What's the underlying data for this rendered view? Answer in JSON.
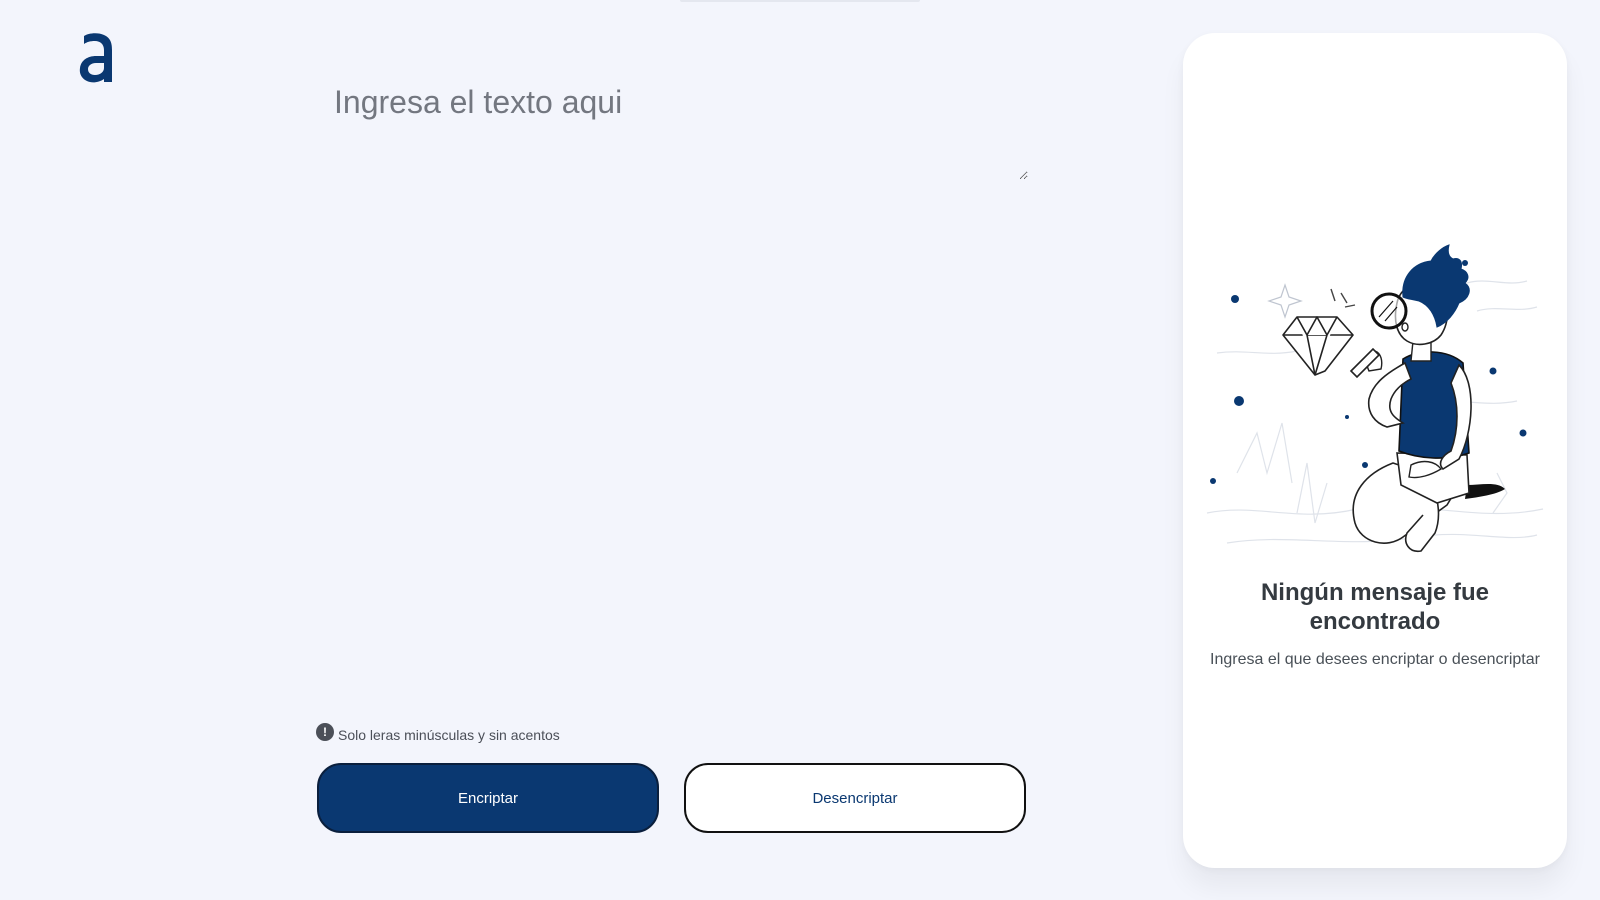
{
  "input": {
    "placeholder": "Ingresa el texto aqui",
    "value": ""
  },
  "hint": {
    "icon": "exclamation-circle-icon",
    "text": "Solo leras minúsculas y sin acentos"
  },
  "buttons": {
    "encrypt_label": "Encriptar",
    "decrypt_label": "Desencriptar"
  },
  "result_panel": {
    "title": "Ningún mensaje fue encontrado",
    "subtitle": "Ingresa el que desees encriptar o desencriptar",
    "illustration": "person-with-magnifying-glass-illustration"
  },
  "logo": {
    "icon": "alura-a-logo"
  },
  "colors": {
    "background": "#f3f5fc",
    "primary": "#0a3871",
    "panel": "#ffffff",
    "placeholder": "#737780"
  }
}
